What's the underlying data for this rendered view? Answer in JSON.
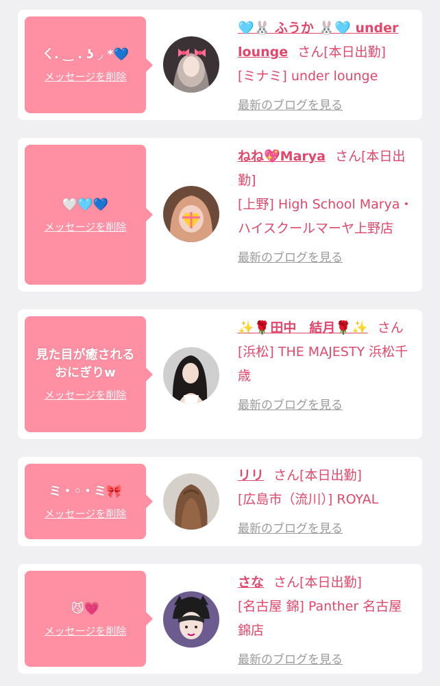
{
  "common": {
    "delete_label": "メッセージを削除",
    "blog_label": "最新のブログを見る",
    "san_label": "さん"
  },
  "cards": [
    {
      "message": "ㄑ. ‿ . ʖ ◞ *💙",
      "name": "🩵🐰 ふうか 🐰🩵 under lounge",
      "status": "[本日出勤]",
      "shop": "[ミナミ] under lounge",
      "avatar_desc": "avatar-girl-pink-bows"
    },
    {
      "message": "🤍🩵💙",
      "name": "ねね💖Marya",
      "status": "[本日出勤]",
      "shop": "[上野] High School Marya・ハイスクールマーヤ上野店",
      "avatar_desc": "avatar-heart-emoji"
    },
    {
      "message": "見た目が癒される おにぎりw",
      "name": "✨🌹田中　結月🌹✨",
      "status": "",
      "shop": "[浜松] THE MAJESTY 浜松千歳",
      "avatar_desc": "avatar-dark-hair"
    },
    {
      "message": "ミ・◦・ミ🎀",
      "name": "リリ",
      "status": "[本日出勤]",
      "shop": "[広島市（流川）] ROYAL",
      "avatar_desc": "avatar-long-brown-hair"
    },
    {
      "message": "😼💗",
      "name": "さな",
      "status": "[本日出勤]",
      "shop": "[名古屋 錦] Panther 名古屋錦店",
      "avatar_desc": "avatar-black-cat-hat"
    }
  ]
}
